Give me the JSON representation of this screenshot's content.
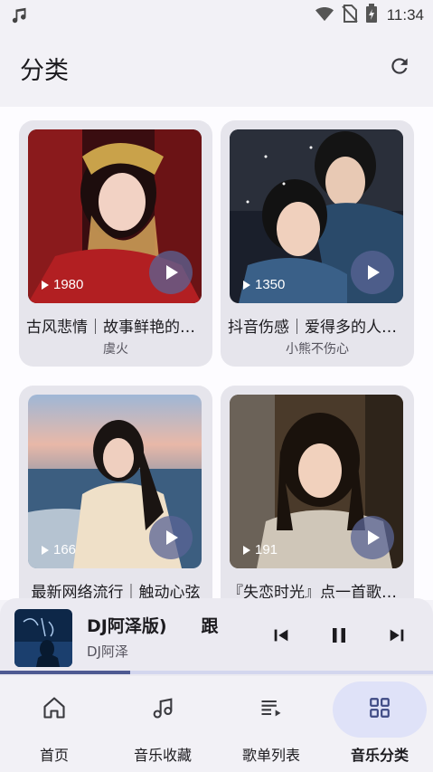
{
  "status_bar": {
    "time": "11:34",
    "icons": [
      "music-note-icon",
      "wifi-icon",
      "no-sim-icon",
      "battery-charging-icon"
    ]
  },
  "header": {
    "title": "分类",
    "refresh_icon": "refresh-icon"
  },
  "playlists": [
    {
      "title": "古风悲情｜故事鲜艳的凋零",
      "subtitle": "虞火",
      "play_count": "1980"
    },
    {
      "title": "抖音伤感｜爱得多的人受苦",
      "subtitle": "小熊不伤心",
      "play_count": "1350"
    },
    {
      "title": "最新网络流行｜触动心弦",
      "subtitle": "",
      "play_count": "166"
    },
    {
      "title": "『失恋时光』点一首歌给你",
      "subtitle": "",
      "play_count": "191"
    }
  ],
  "mini_player": {
    "title": "DJ阿泽版)　　跟",
    "artist": "DJ阿泽",
    "progress": 0.3,
    "controls": [
      "skip-previous-icon",
      "pause-icon",
      "skip-next-icon"
    ]
  },
  "nav": {
    "items": [
      {
        "label": "首页",
        "icon": "home-icon",
        "active": false
      },
      {
        "label": "音乐收藏",
        "icon": "music-note-icon",
        "active": false
      },
      {
        "label": "歌单列表",
        "icon": "playlist-icon",
        "active": false
      },
      {
        "label": "音乐分类",
        "icon": "grid-icon",
        "active": true
      }
    ]
  },
  "colors": {
    "accent": "#4e5a92",
    "nav_active_bg": "#dfe2f8",
    "card_bg": "#e6e5ec",
    "background": "#fdfcff"
  }
}
